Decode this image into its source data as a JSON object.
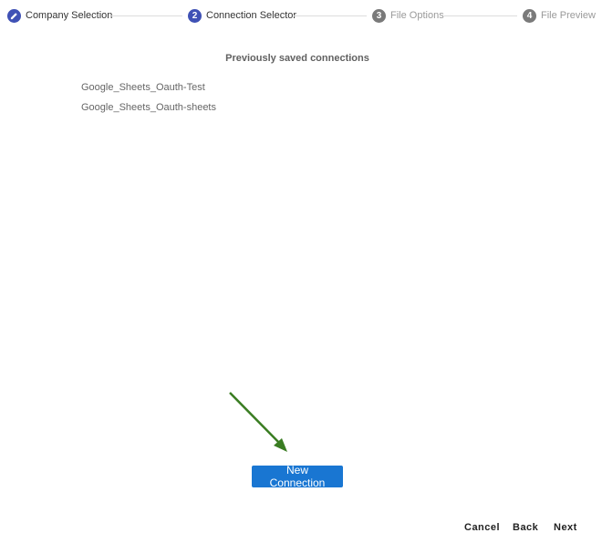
{
  "stepper": {
    "steps": [
      {
        "number": "",
        "icon": "pencil-icon",
        "label": "Company Selection",
        "state": "done"
      },
      {
        "number": "2",
        "label": "Connection Selector",
        "state": "active"
      },
      {
        "number": "3",
        "label": "File Options",
        "state": "inactive"
      },
      {
        "number": "4",
        "label": "File Preview",
        "state": "inactive"
      }
    ]
  },
  "main": {
    "section_title": "Previously saved connections",
    "connections": [
      "Google_Sheets_Oauth-Test",
      "Google_Sheets_Oauth-sheets"
    ],
    "new_connection_label": "New Connection",
    "annotation_color": "#3a7d22"
  },
  "footer": {
    "cancel_label": "Cancel",
    "back_label": "Back",
    "next_label": "Next"
  },
  "colors": {
    "accent": "#3f51b5",
    "button": "#1976d2"
  }
}
